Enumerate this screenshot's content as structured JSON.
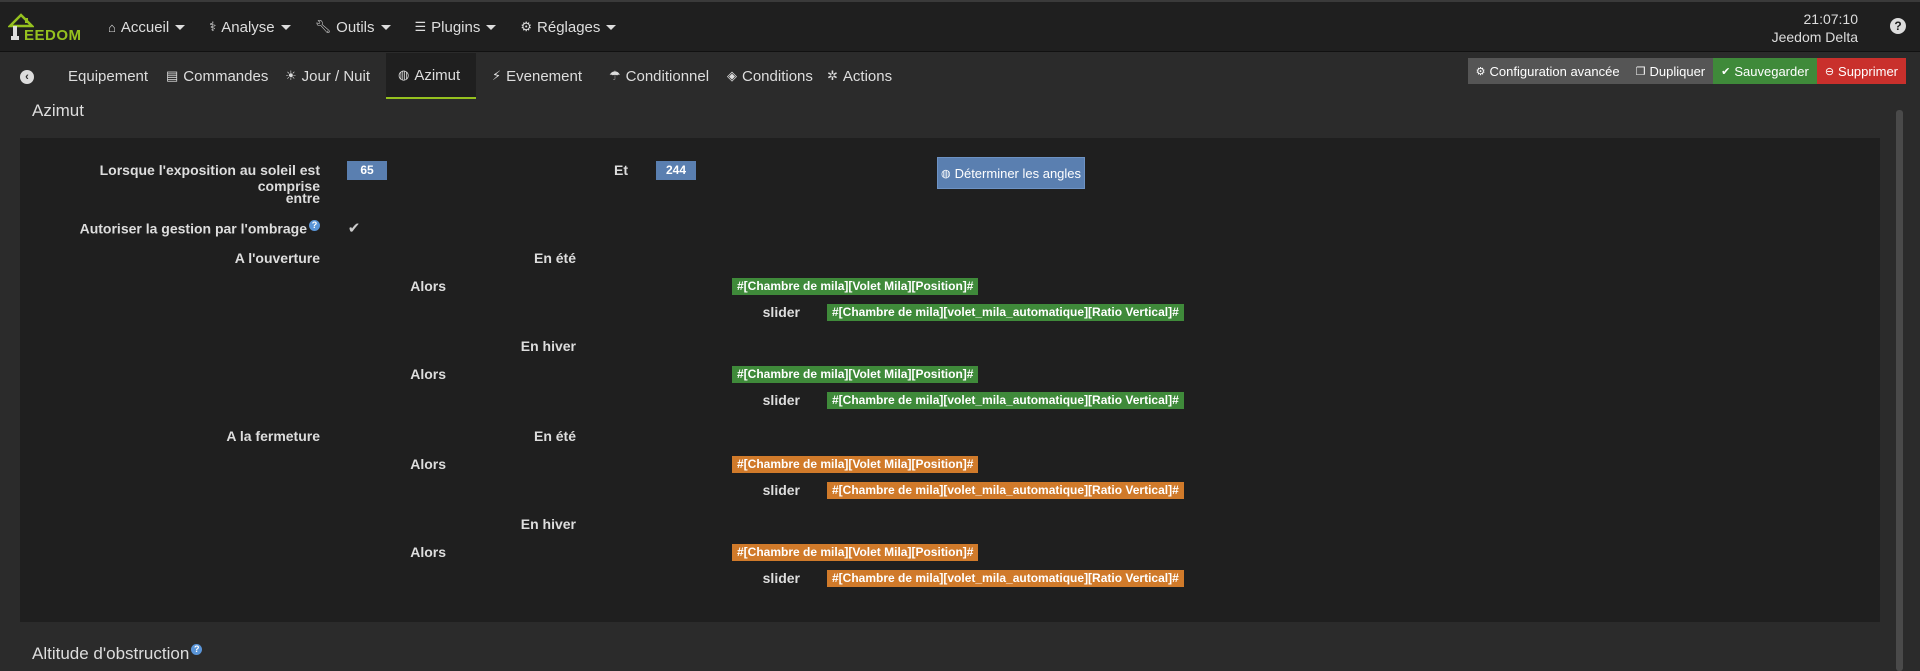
{
  "app": {
    "brand": "EEDOM",
    "time": "21:07:10",
    "user": "Jeedom Delta"
  },
  "menu": [
    {
      "label": "Accueil",
      "icon": "home-icon"
    },
    {
      "label": "Analyse",
      "icon": "stethoscope-icon"
    },
    {
      "label": "Outils",
      "icon": "wrench-icon"
    },
    {
      "label": "Plugins",
      "icon": "list-icon"
    },
    {
      "label": "Réglages",
      "icon": "gears-icon"
    }
  ],
  "tabs": [
    {
      "label": "Equipement"
    },
    {
      "label": "Commandes"
    },
    {
      "label": "Jour / Nuit"
    },
    {
      "label": "Azimut"
    },
    {
      "label": "Evenement"
    },
    {
      "label": "Conditionnel"
    },
    {
      "label": "Conditions"
    },
    {
      "label": "Actions"
    }
  ],
  "actions": {
    "config": "Configuration avancée",
    "duplicate": "Dupliquer",
    "save": "Sauvegarder",
    "delete": "Supprimer"
  },
  "azimut": {
    "title": "Azimut",
    "exposure_label_1": "Lorsque l'exposition au soleil est comprise",
    "exposure_label_2": "entre",
    "min_angle": "65",
    "and_label": "Et",
    "max_angle": "244",
    "determine_button": "Déterminer les angles",
    "shade_label": "Autoriser la gestion par l'ombrage",
    "opening_label": "A l'ouverture",
    "closing_label": "A la fermeture",
    "summer_label": "En été",
    "winter_label": "En hiver",
    "then_label": "Alors",
    "slider_label": "slider",
    "position_cmd": "#[Chambre de mila][Volet Mila][Position]#",
    "ratio_cmd": "#[Chambre de mila][volet_mila_automatique][Ratio Vertical]#"
  },
  "obstruction": {
    "title": "Altitude d'obstruction"
  },
  "colors": {
    "accent": "#95c11f",
    "badge": "#5a7fb0",
    "opening": "#3f8a3a",
    "closing": "#d07a2a"
  }
}
